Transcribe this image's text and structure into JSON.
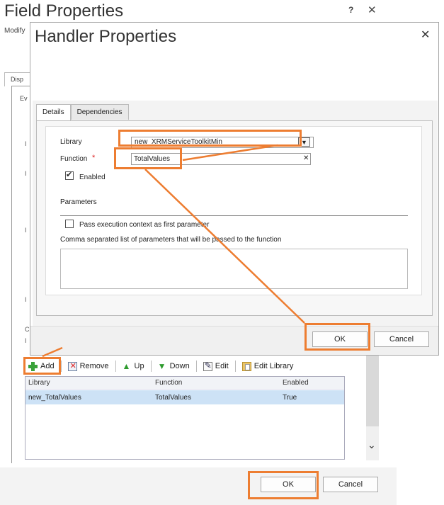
{
  "background_dialog": {
    "title": "Field Properties",
    "help_label": "?",
    "close_label": "✕",
    "subtitle": "Modify",
    "tab_label": "Disp",
    "section_label": "Ev",
    "side_ticks": [
      "I",
      "I",
      "I",
      "I",
      "C",
      "I",
      "I"
    ],
    "toolbar": {
      "add_label": "Add",
      "remove_label": "Remove",
      "up_label": "Up",
      "down_label": "Down",
      "edit_label": "Edit",
      "edit_library_label": "Edit Library"
    },
    "grid": {
      "columns": [
        "Library",
        "Function",
        "Enabled"
      ],
      "rows": [
        {
          "library": "new_TotalValues",
          "function": "TotalValues",
          "enabled": "True"
        }
      ]
    },
    "scroll_down_icon": "chevron-down-icon",
    "ok_label": "OK",
    "cancel_label": "Cancel"
  },
  "handler_dialog": {
    "title": "Handler Properties",
    "close_label": "✕",
    "tabs": [
      {
        "label": "Details",
        "active": true
      },
      {
        "label": "Dependencies",
        "active": false
      }
    ],
    "library_label": "Library",
    "library_value": "new_XRMServiceToolkitMin",
    "function_label": "Function",
    "required_marker": "*",
    "function_value": "TotalValues",
    "clear_icon": "✕",
    "enabled_label": "Enabled",
    "enabled_checked": true,
    "parameters_heading": "Parameters",
    "pass_context_label": "Pass execution context as first parameter",
    "pass_context_checked": false,
    "parameters_list_label": "Comma separated list of parameters that will be passed to the function",
    "parameters_value": "",
    "ok_label": "OK",
    "cancel_label": "Cancel"
  },
  "colors": {
    "annotation": "#ed7d31",
    "selected_row": "#cde2f6",
    "required": "#dd2222"
  }
}
